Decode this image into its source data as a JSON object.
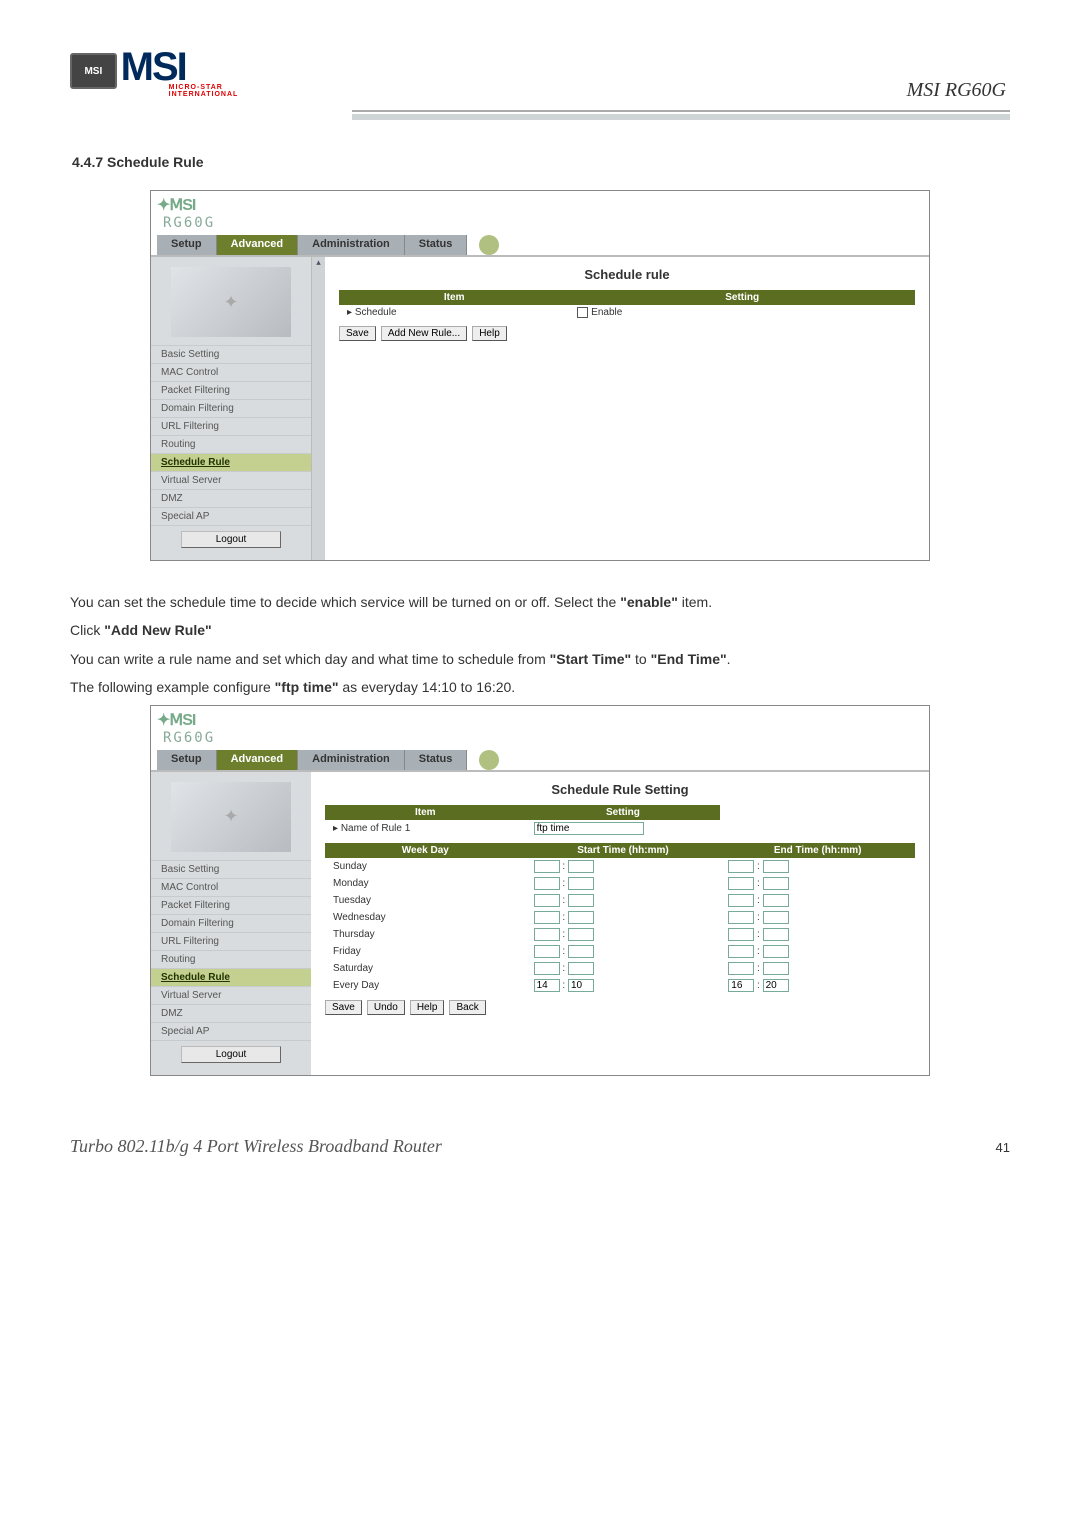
{
  "header": {
    "logo_badge": "MSI",
    "logo_text": "MSI",
    "logo_sub": "MICRO-STAR INTERNATIONAL",
    "product": "MSI RG60G"
  },
  "section_title": "4.4.7 Schedule Rule",
  "shot1": {
    "model": "RG60G",
    "tabs": [
      "Setup",
      "Advanced",
      "Administration",
      "Status"
    ],
    "active_tab": 1,
    "side_items": [
      "Basic Setting",
      "MAC Control",
      "Packet Filtering",
      "Domain Filtering",
      "URL Filtering",
      "Routing",
      "Schedule Rule",
      "Virtual Server",
      "DMZ",
      "Special AP"
    ],
    "side_selected": 6,
    "logout": "Logout",
    "content_title": "Schedule rule",
    "table_headers": [
      "Item",
      "Setting"
    ],
    "row_label": "Schedule",
    "row_setting": "Enable",
    "buttons": [
      "Save",
      "Add New Rule...",
      "Help"
    ]
  },
  "paragraphs": {
    "p1_a": "You can set the schedule time to decide which service will be turned on or off. Select the ",
    "p1_b": "\"enable\"",
    "p1_c": " item.",
    "p2_a": "Click ",
    "p2_b": "\"Add New Rule\"",
    "p3_a": "You can write a rule name and set which day and what time to schedule from ",
    "p3_b": "\"Start Time\"",
    "p3_c": " to ",
    "p3_d": "\"End Time\"",
    "p3_e": ".",
    "p4_a": "The following example configure ",
    "p4_b": "\"ftp time\"",
    "p4_c": " as everyday 14:10 to 16:20."
  },
  "shot2": {
    "model": "RG60G",
    "tabs": [
      "Setup",
      "Advanced",
      "Administration",
      "Status"
    ],
    "active_tab": 1,
    "side_items": [
      "Basic Setting",
      "MAC Control",
      "Packet Filtering",
      "Domain Filtering",
      "URL Filtering",
      "Routing",
      "Schedule Rule",
      "Virtual Server",
      "DMZ",
      "Special AP"
    ],
    "side_selected": 6,
    "logout": "Logout",
    "content_title": "Schedule Rule Setting",
    "row1_headers": [
      "Item",
      "Setting"
    ],
    "row1_label": "Name of Rule 1",
    "row1_value": "ftp time",
    "grid_headers": [
      "Week Day",
      "Start Time (hh:mm)",
      "End Time (hh:mm)"
    ],
    "days": [
      "Sunday",
      "Monday",
      "Tuesday",
      "Wednesday",
      "Thursday",
      "Friday",
      "Saturday",
      "Every Day"
    ],
    "every_start_hh": "14",
    "every_start_mm": "10",
    "every_end_hh": "16",
    "every_end_mm": "20",
    "buttons": [
      "Save",
      "Undo",
      "Help",
      "Back"
    ]
  },
  "footer": {
    "text": "Turbo 802.11b/g 4 Port Wireless Broadband Router",
    "page": "41"
  }
}
